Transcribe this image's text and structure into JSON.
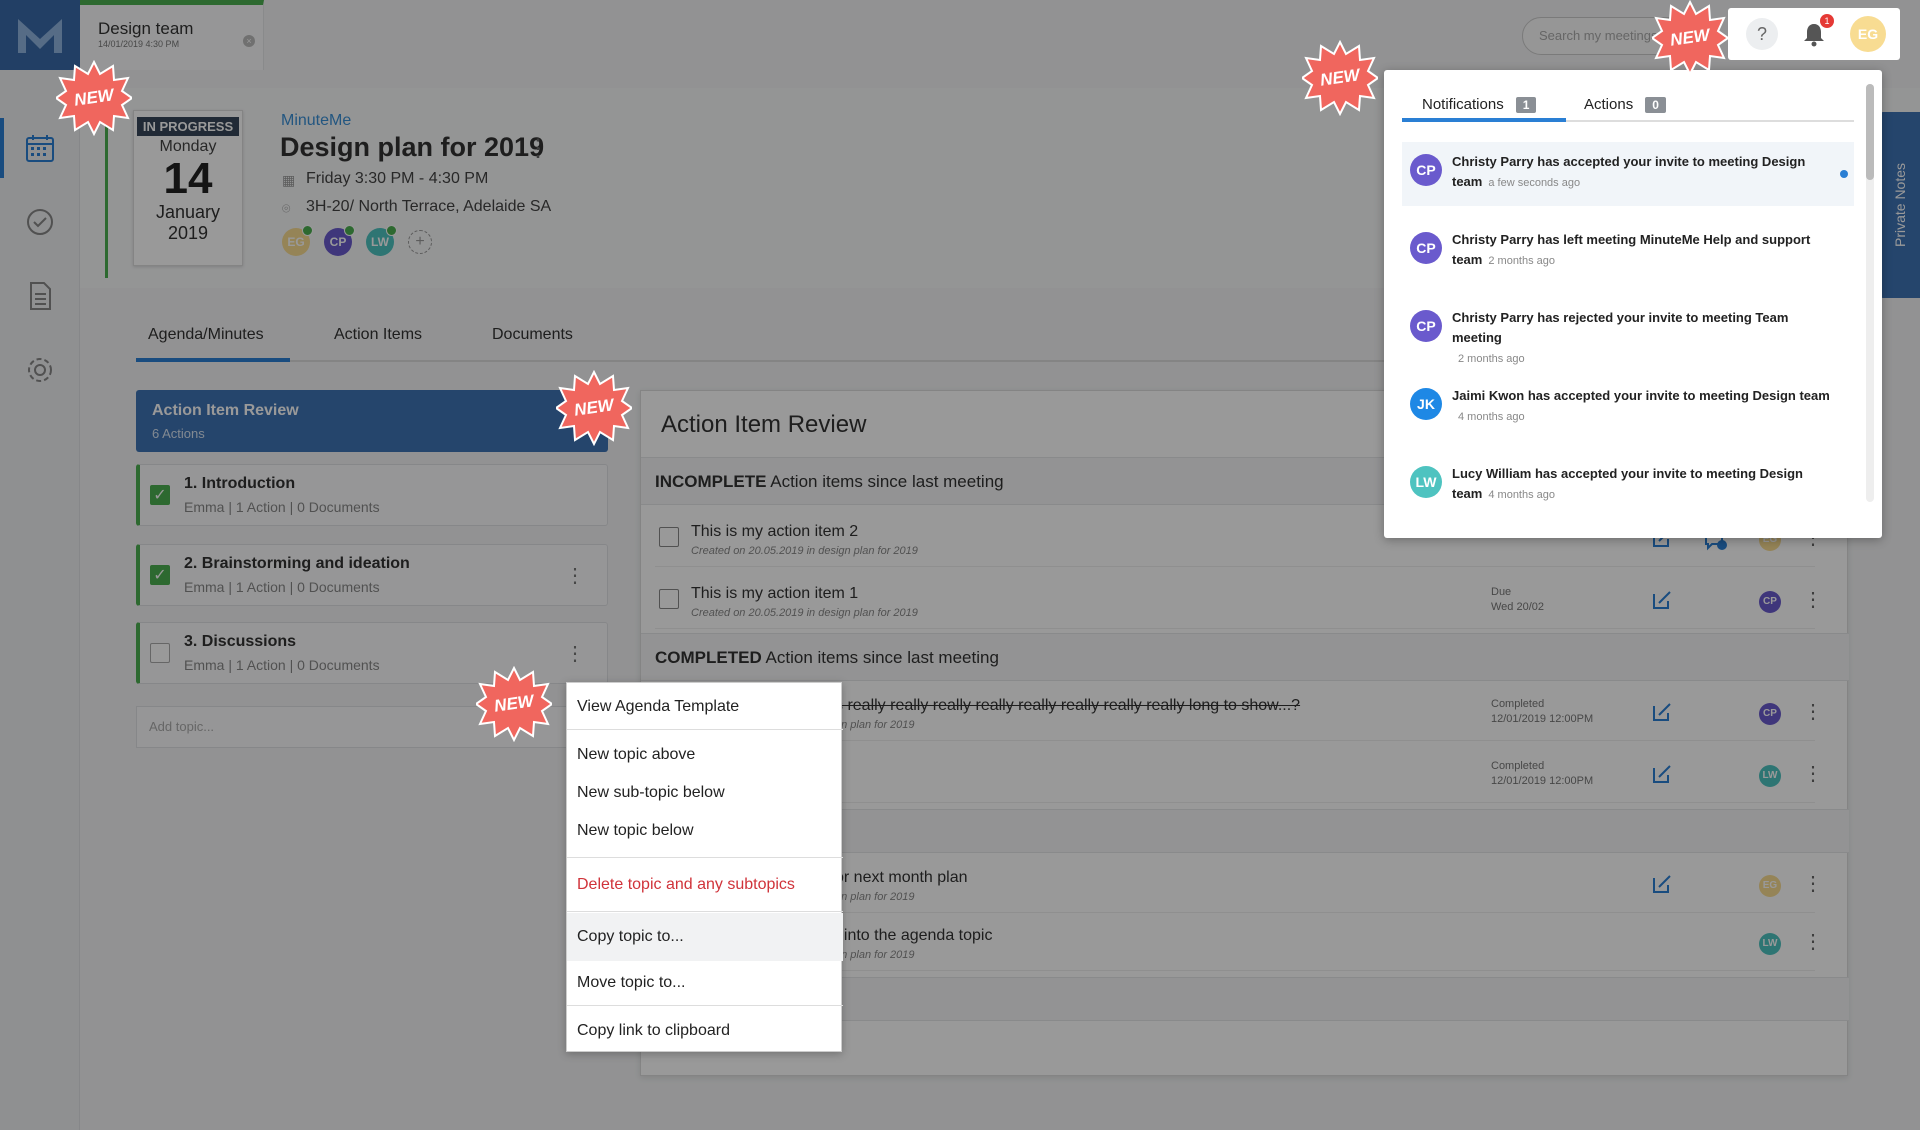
{
  "meeting_tab": {
    "title": "Design team",
    "date": "14/01/2019 4:30 PM"
  },
  "search": {
    "placeholder": "Search my meetings"
  },
  "topbar": {
    "help": "?",
    "bell_count": "1",
    "user_initials": "EG"
  },
  "date_card": {
    "status": "IN PROGRESS",
    "weekday": "Monday",
    "day": "14",
    "month": "January",
    "year": "2019"
  },
  "meeting": {
    "org": "MinuteMe",
    "title": "Design plan for 2019",
    "time": "Friday 3:30 PM - 4:30 PM",
    "location": "3H-20/ North Terrace, Adelaide SA",
    "attendees": [
      "EG",
      "CP",
      "LW"
    ]
  },
  "tabs": [
    "Agenda/Minutes",
    "Action Items",
    "Documents"
  ],
  "topics": {
    "active": {
      "title": "Action Item Review",
      "subtitle": "6 Actions"
    },
    "items": [
      {
        "title": "1. Introduction",
        "meta": "Emma  |  1 Action  |  0 Documents"
      },
      {
        "title": "2. Brainstorming and ideation",
        "meta": "Emma  |  1 Action  |  0 Documents"
      },
      {
        "title": "3. Discussions",
        "meta": "Emma  |  1 Action  |  0 Documents"
      }
    ],
    "add_placeholder": "Add topic..."
  },
  "panel": {
    "title": "Action Item Review",
    "incomplete_bold": "INCOMPLETE",
    "incomplete_rest": " Action items since last meeting",
    "completed_bold": "COMPLETED",
    "completed_rest": " Action items since last meeting",
    "items": [
      {
        "title": "This is my action item 2",
        "sub": "Created on 20.05.2019 in design plan for 2019",
        "due1": "",
        "due2": "",
        "avatar": "EG"
      },
      {
        "title": "This is my action item 1",
        "sub": "Created on 20.05.2019 in design plan for 2019",
        "due1": "Due",
        "due2": "Wed 20/02",
        "avatar": "CP"
      },
      {
        "title": "s really really really really really really really really long to show...?",
        "sub": "gn plan for 2019",
        "due1": "Completed",
        "due2": "12/01/2019 12:00PM",
        "avatar": "CP"
      },
      {
        "title": "",
        "sub": "",
        "due1": "Completed",
        "due2": "12/01/2019 12:00PM",
        "avatar": "LW"
      },
      {
        "title": "or next month plan",
        "sub": "gn plan for 2019",
        "due1": "",
        "due2": "",
        "avatar": "EG"
      },
      {
        "title": "t into the agenda topic",
        "sub": "gn plan for 2019",
        "due1": "",
        "due2": "",
        "avatar": "LW"
      }
    ]
  },
  "private_notes": "Private Notes",
  "context_menu": {
    "view_template": "View Agenda Template",
    "new_above": "New topic above",
    "new_sub": "New sub-topic below",
    "new_below": "New topic below",
    "delete": "Delete topic and any subtopics",
    "copy_to": "Copy topic to...",
    "move_to": "Move topic to...",
    "copy_link": "Copy link to clipboard"
  },
  "notifications": {
    "tab_notifications": "Notifications",
    "tab_notifications_count": "1",
    "tab_actions": "Actions",
    "tab_actions_count": "0",
    "items": [
      {
        "initials": "CP",
        "text": "Christy Parry has accepted your invite to meeting Design team",
        "time": "a few seconds ago"
      },
      {
        "initials": "CP",
        "text": "Christy Parry has left meeting MinuteMe Help and support team",
        "time": "2 months ago"
      },
      {
        "initials": "CP",
        "text": "Christy Parry has rejected your invite to meeting Team meeting",
        "time": "2 months ago"
      },
      {
        "initials": "JK",
        "text": "Jaimi Kwon has accepted your invite to meeting Design team",
        "time": "4 months ago"
      },
      {
        "initials": "LW",
        "text": "Lucy William has accepted your invite to meeting Design team",
        "time": "4 months ago"
      }
    ]
  },
  "new_label": "NEW",
  "colors": {
    "accent": "#2a7fd4",
    "brand": "#3f73b5",
    "success": "#4caf50",
    "danger": "#d0333a",
    "cp": "#6a5acd",
    "lw": "#4ec3c0",
    "eg": "#f8dc92",
    "jk": "#1e88e5"
  }
}
